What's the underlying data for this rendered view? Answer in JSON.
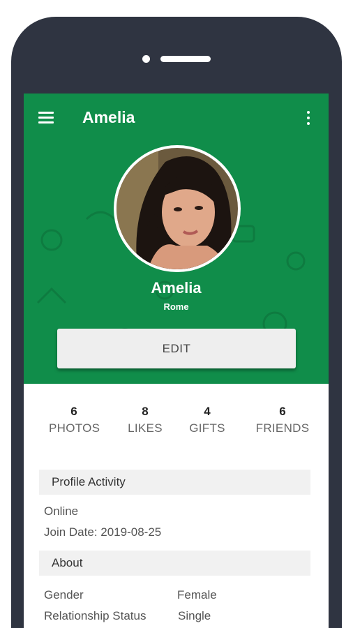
{
  "appbar": {
    "title": "Amelia"
  },
  "profile": {
    "name": "Amelia",
    "city": "Rome",
    "edit_label": "EDIT"
  },
  "stats": [
    {
      "count": "6",
      "label": "PHOTOS"
    },
    {
      "count": "8",
      "label": "LIKES"
    },
    {
      "count": "4",
      "label": "GIFTS"
    },
    {
      "count": "6",
      "label": "FRIENDS"
    }
  ],
  "activity": {
    "title": "Profile Activity",
    "status": "Online",
    "join_date": "Join Date: 2019-08-25"
  },
  "about": {
    "title": "About",
    "rows": [
      {
        "label": "Gender",
        "value": "Female"
      },
      {
        "label": "Relationship Status",
        "value": "Single"
      }
    ]
  },
  "colors": {
    "accent": "#108d4a",
    "phone_frame": "#2f3441",
    "section_bg": "#f1f1f1"
  },
  "icons": [
    "menu-icon",
    "more-vert-icon"
  ]
}
